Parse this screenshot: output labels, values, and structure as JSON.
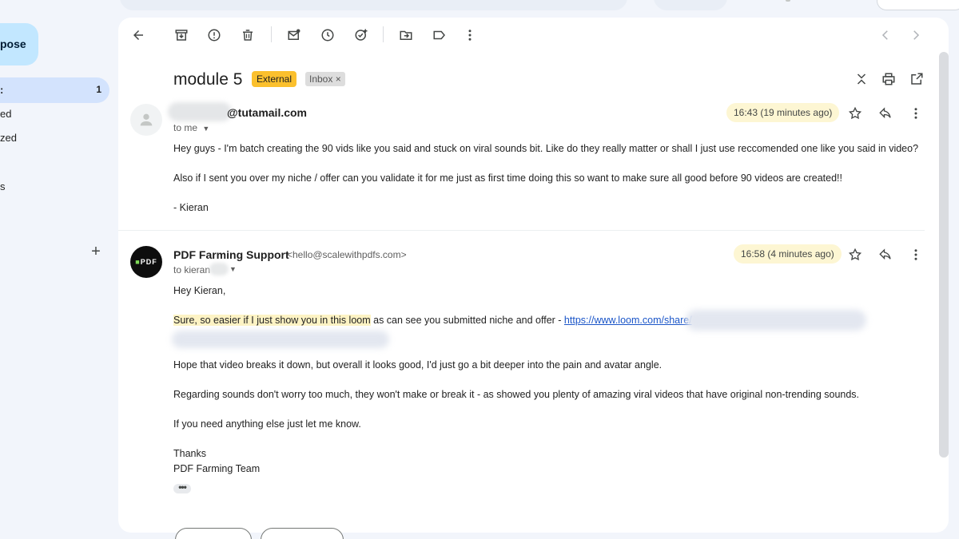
{
  "sidebar": {
    "compose_label": "pose",
    "items": [
      {
        "label": ":",
        "count": "1"
      },
      {
        "label": "ed",
        "count": ""
      },
      {
        "label": "zed",
        "count": ""
      },
      {
        "label": "s",
        "count": ""
      }
    ],
    "add_label": "+"
  },
  "subject": {
    "title": "module 5",
    "badge_external": "External",
    "badge_inbox": "Inbox ×"
  },
  "messages": [
    {
      "sender_email": "@tutamail.com",
      "to": "to me",
      "time": "16:43 (19 minutes ago)",
      "paragraphs": [
        "Hey guys - I'm batch creating the 90 vids like you said and stuck on viral sounds bit. Like do they really matter or shall I just use reccomended one like you said in video?",
        "Also if I sent you over my niche / offer can you validate it for me just as first time doing this so want to make sure all good before 90 videos are created!!",
        "- Kieran"
      ]
    },
    {
      "sender_name": "PDF Farming Support",
      "sender_email": "<hello@scalewithpdfs.com>",
      "to": "to kieran",
      "time": "16:58 (4 minutes ago)",
      "avatar_text": "PDF",
      "greeting": "Hey Kieran,",
      "highlight_text": "Sure, so easier if I just show you in this loom",
      "line2_rest": " as can see you submitted niche and offer - ",
      "link": "https://www.loom.com/share/",
      "paragraphs": [
        "Hope that video breaks it down, but overall it looks good, I'd just go a bit deeper into the pain and avatar angle.",
        "Regarding sounds don't worry too much, they won't make or break it - as showed you plenty of amazing viral videos that have original non-trending sounds.",
        "If you need anything else just let me know."
      ],
      "signoff": "Thanks",
      "signature": "PDF Farming Team",
      "more": "•••"
    }
  ]
}
